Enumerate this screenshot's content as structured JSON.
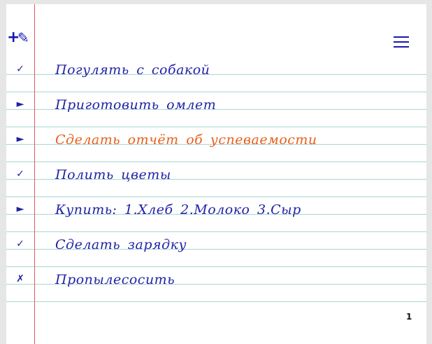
{
  "toolbar": {
    "add_glyph": "+",
    "edit_glyph": "✎",
    "menu_icon": "hamburger-menu-icon"
  },
  "colors": {
    "ink": "#2222a8",
    "highlight": "#e8601c",
    "margin": "#e05a5a",
    "ruling": "#a9d6d6"
  },
  "tasks": [
    {
      "marker": "✓",
      "status": "done",
      "text": "Погулять с собакой"
    },
    {
      "marker": "►",
      "status": "active",
      "text": "Приготовить омлет"
    },
    {
      "marker": "►",
      "status": "active",
      "text": "Сделать отчёт об успеваемости",
      "highlight": true
    },
    {
      "marker": "✓",
      "status": "done",
      "text": "Полить цветы"
    },
    {
      "marker": "►",
      "status": "active",
      "text": "Купить: 1.Хлеб 2.Молоко 3.Сыр"
    },
    {
      "marker": "✓",
      "status": "done",
      "text": "Сделать зарядку"
    },
    {
      "marker": "✗",
      "status": "cancelled",
      "text": "Пропылесосить"
    }
  ],
  "page_number": "1"
}
